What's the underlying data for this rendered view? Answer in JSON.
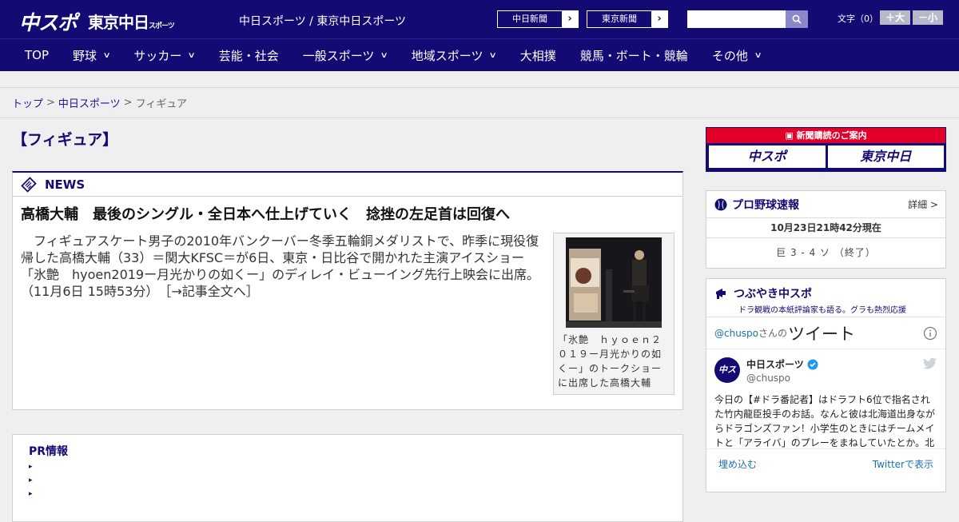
{
  "header": {
    "logo_primary": "中スポ",
    "logo_secondary": "東京中日",
    "logo_secondary_small": "スポーツ",
    "site_title": "中日スポーツ / 東京中日スポーツ",
    "ext_links": [
      {
        "label": "中日新聞"
      },
      {
        "label": "東京新聞"
      }
    ],
    "search": {
      "value": "",
      "placeholder": ""
    },
    "font_size": {
      "label": "文字（0）",
      "bigger": "＋大",
      "smaller": "－小"
    }
  },
  "nav": {
    "items": [
      {
        "label": "TOP",
        "has_menu": false
      },
      {
        "label": "野球",
        "has_menu": true
      },
      {
        "label": "サッカー",
        "has_menu": true
      },
      {
        "label": "芸能・社会",
        "has_menu": false
      },
      {
        "label": "一般スポーツ",
        "has_menu": true
      },
      {
        "label": "地域スポーツ",
        "has_menu": true
      },
      {
        "label": "大相撲",
        "has_menu": false
      },
      {
        "label": "競馬・ボート・競輪",
        "has_menu": false
      },
      {
        "label": "その他",
        "has_menu": true
      }
    ]
  },
  "breadcrumb": {
    "items": [
      "トップ",
      "中日スポーツ"
    ],
    "separator": ">",
    "current": "フィギュア"
  },
  "main": {
    "page_title": "【フィギュア】",
    "news": {
      "section_label": "NEWS",
      "headline": "高橋大輔　最後のシングル・全日本へ仕上げていく　捻挫の左足首は回復へ",
      "body": "　フィギュアスケート男子の2010年バンクーバー冬季五輪銅メダリストで、昨季に現役復帰した高橋大輔（33）＝関大KFSC＝が6日、東京・日比谷で開かれた主演アイスショー「氷艶　hyoen2019ー月光かりの如くー」のディレイ・ビューイング先行上映会に出席。",
      "timestamp": "（11月6日 15時53分）",
      "more_link": "［→記事全文へ］",
      "photo_caption": "「氷艶　ｈｙｏｅｎ２０１９ー月光かりの如くー」のトークショーに出席した高橋大輔"
    },
    "pr": {
      "title": "PR情報",
      "items": [
        "",
        "",
        ""
      ]
    }
  },
  "side": {
    "subscription": {
      "header": "新聞購読のご案内",
      "buttons": [
        "中スポ",
        "東京中日"
      ]
    },
    "baseball": {
      "title": "プロ野球速報",
      "more": "詳細 >",
      "updated": "10月23日21時42分現在",
      "score_line": "巨  3 - 4  ソ  （終了）"
    },
    "tweets": {
      "title": "つぶやき中スポ",
      "subtitle": "ドラ観戦の本紙評論家も語る。グラも熱烈応援",
      "handle": "@chuspo",
      "handle_suffix": "さんの",
      "tweets_label": "ツイート",
      "avatar_text": "中スポ",
      "user_name": "中日スポーツ",
      "user_id": "@chuspo",
      "tweet_text": "今日の【#ドラ番記者】はドラフト6位で指名された竹内龍臣投手のお話。なんと彼は北海道出身ながらドラゴンズファン！小学生のときにはチームメイトと「アライバ」のプレーをまねしていたとか。北国",
      "embed_label": "埋め込む",
      "view_label": "Twitterで表示"
    }
  },
  "colors": {
    "brand": "#140a73",
    "accent_red": "#e0002a",
    "link_blue": "#1b6fb0"
  }
}
